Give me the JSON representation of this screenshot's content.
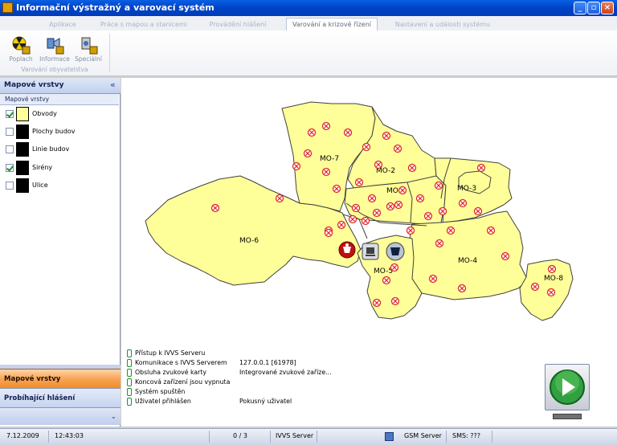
{
  "window": {
    "title": "Informační výstražný a varovací systém"
  },
  "ribbon": {
    "tabs": [
      {
        "label": "Aplikace",
        "active": false
      },
      {
        "label": "Práce s mapou a stanicemi",
        "active": false
      },
      {
        "label": "Provádění hlášení",
        "active": false
      },
      {
        "label": "Varování a krizové řízení",
        "active": true
      },
      {
        "label": "Nastavení a události systému",
        "active": false
      }
    ],
    "buttons": [
      {
        "label": "Poplach",
        "icon": "radiation-siren-icon"
      },
      {
        "label": "Informace",
        "icon": "info-speaker-icon"
      },
      {
        "label": "Speciální",
        "icon": "special-signal-icon"
      }
    ],
    "group_label": "Varování obyvatelstva"
  },
  "left_panel": {
    "title": "Mapové vrstvy",
    "collapse_glyph": "«",
    "subheader": "Mapové vrstvy",
    "layers": [
      {
        "name": "Obvody",
        "checked": true,
        "color": "#ffff99"
      },
      {
        "name": "Plochy budov",
        "checked": false,
        "color": "#000000"
      },
      {
        "name": "Linie budov",
        "checked": false,
        "color": "#000000"
      },
      {
        "name": "Sirény",
        "checked": true,
        "color": "#000000"
      },
      {
        "name": "Ulice",
        "checked": false,
        "color": "#000000"
      }
    ],
    "nav": {
      "active": "Mapové vrstvy",
      "second": "Probíhající hlášení",
      "more": "⌄"
    }
  },
  "map": {
    "district_labels": [
      "MO-7",
      "MO-2",
      "MO-1",
      "MO-3",
      "MO-6",
      "MO-4",
      "MO-5",
      "MO-8"
    ],
    "district_color": "#ffff99",
    "siren_color": "#e02020"
  },
  "status": [
    {
      "key": "Přístup k IVVS Serveru",
      "value": ""
    },
    {
      "key": "Komunikace s IVVS Serverem",
      "value": "127.0.0.1 [61978]"
    },
    {
      "key": "Obsluha zvukové karty",
      "value": "Integrované zvukové zaříze..."
    },
    {
      "key": "Koncová zařízení jsou vypnuta",
      "value": ""
    },
    {
      "key": "Systém spuštěn",
      "value": ""
    },
    {
      "key": "Uživatel přihlášen",
      "value": "Pokusný uživatel"
    }
  ],
  "statusbar": {
    "date": "7.12.2009",
    "time": "12:43:03",
    "counter": "0 / 3",
    "ivvs": "IVVS Server",
    "gsm": "GSM Server",
    "sms": "SMS: ???"
  }
}
